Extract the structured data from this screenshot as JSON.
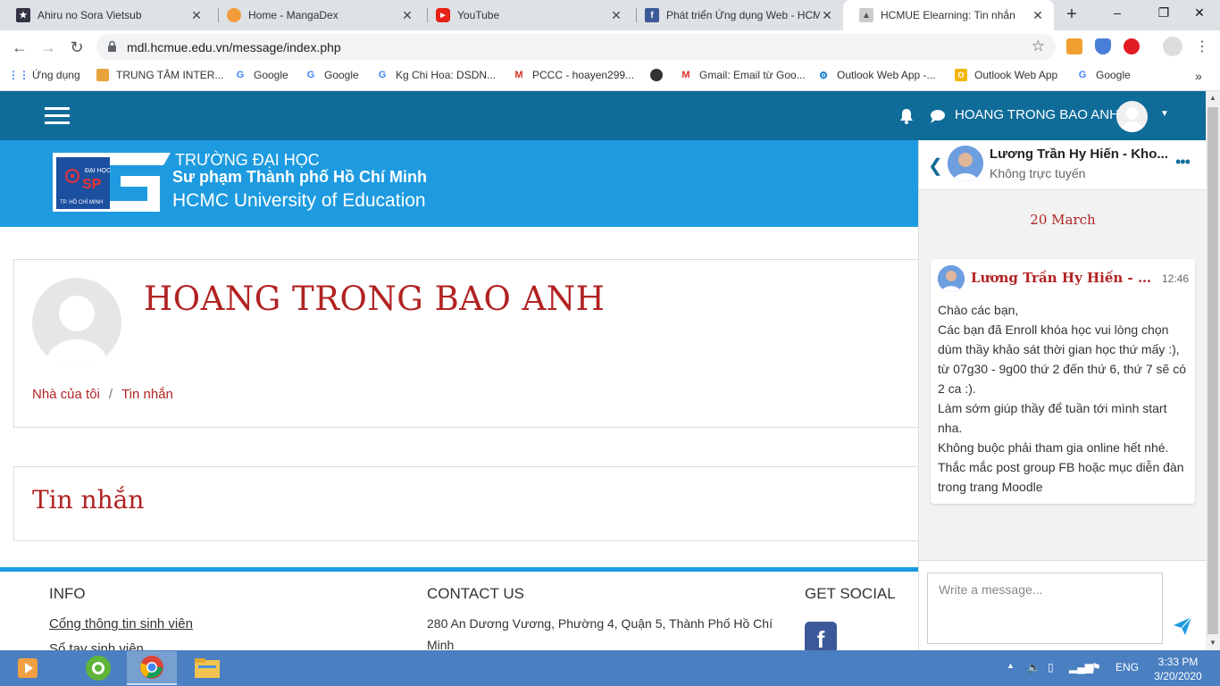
{
  "browser": {
    "tabs": [
      {
        "title": "Ahiru no Sora Vietsub",
        "icon": "anime-icon"
      },
      {
        "title": "Home - MangaDex",
        "icon": "mangadex-icon"
      },
      {
        "title": "YouTube",
        "icon": "youtube-icon"
      },
      {
        "title": "Phát triển Ứng dụng Web - HCM",
        "icon": "facebook-icon"
      },
      {
        "title": "HCMUE Elearning: Tin nhắn",
        "icon": "moodle-icon",
        "active": true
      }
    ],
    "new_tab": "+",
    "window_controls": {
      "minimize": "–",
      "restore": "❐",
      "close": "✕"
    },
    "url": "mdl.hcmue.edu.vn/message/index.php",
    "bookmarks": [
      {
        "label": "Ứng dụng",
        "icon": "apps-icon"
      },
      {
        "label": "TRUNG TÂM INTER...",
        "icon": "center-icon"
      },
      {
        "label": "Google",
        "icon": "google-icon"
      },
      {
        "label": "Google",
        "icon": "google-icon"
      },
      {
        "label": "Kg Chi Hoa: DSDN...",
        "icon": "google-icon"
      },
      {
        "label": "PCCC - hoayen299...",
        "icon": "gmail-icon"
      },
      {
        "label": "",
        "icon": "globe-icon"
      },
      {
        "label": "Gmail: Email từ Goo...",
        "icon": "gmail-icon"
      },
      {
        "label": "Outlook Web App -...",
        "icon": "outlook-icon"
      },
      {
        "label": "Outlook Web App",
        "icon": "outlook-icon"
      },
      {
        "label": "Google",
        "icon": "google-icon"
      }
    ],
    "bookmarks_more": "»"
  },
  "navbar": {
    "user_name": "HOANG TRONG BAO ANH"
  },
  "banner": {
    "logo_small_top": "ĐẠI HỌC",
    "logo_small_mid": "SP",
    "logo_small_bottom": "TP. HỒ CHÍ MINH",
    "line1": "TRƯỜNG ĐẠI HỌC",
    "line2": "Sư phạm Thành phố Hồ Chí Minh",
    "line3": "HCMC University of Education"
  },
  "profile": {
    "name": "HOANG TRONG BAO ANH",
    "breadcrumbs": [
      "Nhà của tôi",
      "Tin nhắn"
    ],
    "breadcrumb_sep": "/"
  },
  "messages_heading": "Tin nhắn",
  "footer": {
    "info_heading": "INFO",
    "info_links": [
      "Cổng thông tin sinh viên",
      "Sổ tay sinh viên"
    ],
    "contact_heading": "CONTACT US",
    "contact_address": "280 An Dương Vương, Phường 4, Quận 5, Thành Phố Hồ Chí Minh",
    "social_heading": "GET SOCIAL",
    "facebook_glyph": "f"
  },
  "drawer": {
    "contact_name": "Lương Trần Hy Hiến - Kho...",
    "contact_status": "Không trực tuyến",
    "more": "•••",
    "day_label": "20 March",
    "message": {
      "sender": "Lương Trần Hy Hiến - K...",
      "time": "12:46",
      "lines": [
        "Chào các bạn,",
        "Các bạn đã Enroll khóa học vui lòng chọn dùm thầy khảo sát thời gian học thứ mấy :), từ 07g30 - 9g00 thứ 2 đến thứ 6, thứ 7 sẽ có 2 ca :).",
        "Làm sớm giúp thầy để tuần tới mình start nha.",
        "Không buộc phải tham gia online hết nhé.",
        "Thắc mắc post group FB hoặc mục diễn đàn trong trang Moodle"
      ]
    },
    "compose_placeholder": "Write a message..."
  },
  "taskbar": {
    "language": "ENG",
    "time": "3:33 PM",
    "date": "3/20/2020"
  },
  "colors": {
    "navbar": "#0f6c99",
    "banner": "#1e9be0",
    "accent_red": "#b22222"
  }
}
